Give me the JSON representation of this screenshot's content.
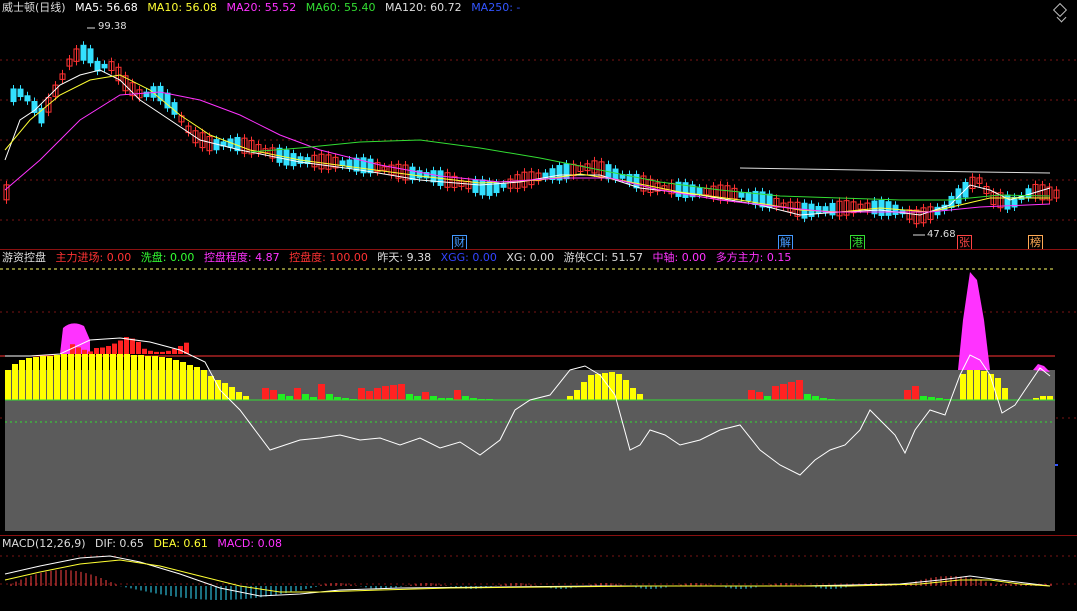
{
  "main": {
    "title": "威士顿(日线)",
    "ma": [
      {
        "label": "MA5: 56.68",
        "color": "#ffffff"
      },
      {
        "label": "MA10: 56.08",
        "color": "#ffff33"
      },
      {
        "label": "MA20: 55.52",
        "color": "#ff33ff"
      },
      {
        "label": "MA60: 55.40",
        "color": "#33dd33"
      },
      {
        "label": "MA120: 60.72",
        "color": "#dddddd"
      },
      {
        "label": "MA250: -",
        "color": "#3355ff"
      }
    ],
    "high_label": "99.38",
    "low_label": "47.68",
    "events": [
      {
        "text": "财",
        "color": "#4499ff"
      },
      {
        "text": "解",
        "color": "#4499ff"
      },
      {
        "text": "港",
        "color": "#33dd33"
      },
      {
        "text": "张",
        "color": "#ff4444"
      },
      {
        "text": "榜",
        "color": "#ffaa55"
      }
    ]
  },
  "indicator": {
    "title": "游资控盘",
    "fields": [
      {
        "label": "主力进场:",
        "value": "0.00",
        "color": "#ff3333"
      },
      {
        "label": "洗盘:",
        "value": "0.00",
        "color": "#33ff33"
      },
      {
        "label": "控盘程度:",
        "value": "4.87",
        "color": "#ff33ff"
      },
      {
        "label": "控盘度:",
        "value": "100.00",
        "color": "#ff3333"
      },
      {
        "label": "昨天:",
        "value": "9.38",
        "color": "#dddddd"
      },
      {
        "label": "XGG:",
        "value": "0.00",
        "color": "#3344ff"
      },
      {
        "label": "XG:",
        "value": "0.00",
        "color": "#dddddd"
      },
      {
        "label": "游侠CCI:",
        "value": "51.57",
        "color": "#dddddd"
      },
      {
        "label": "中轴:",
        "value": "0.00",
        "color": "#ff33ff"
      },
      {
        "label": "多方主力:",
        "value": "0.15",
        "color": "#ff33ff"
      }
    ]
  },
  "macd": {
    "title": "MACD(12,26,9)",
    "fields": [
      {
        "label": "DIF: 0.65",
        "color": "#dddddd"
      },
      {
        "label": "DEA: 0.61",
        "color": "#ffff33"
      },
      {
        "label": "MACD: 0.08",
        "color": "#ff33ff"
      }
    ]
  }
}
